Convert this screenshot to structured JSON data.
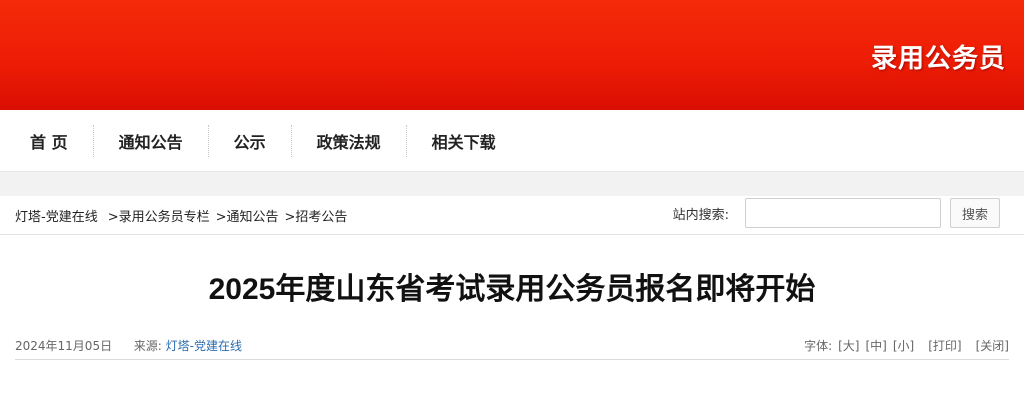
{
  "banner": {
    "title": "录用公务员"
  },
  "nav": {
    "items": [
      {
        "label": "首 页"
      },
      {
        "label": "通知公告"
      },
      {
        "label": "公示"
      },
      {
        "label": "政策法规"
      },
      {
        "label": "相关下载"
      }
    ]
  },
  "breadcrumb": {
    "items": [
      "灯塔-党建在线",
      ">录用公务员专栏",
      ">通知公告",
      ">招考公告"
    ]
  },
  "search": {
    "label": "站内搜索:",
    "input_value": "",
    "button_label": "搜索"
  },
  "article": {
    "title": "2025年度山东省考试录用公务员报名即将开始",
    "date": "2024年11月05日",
    "source_label": "来源:",
    "source_link": "灯塔-党建在线",
    "font_label": "字体:",
    "font_large": "[大]",
    "font_medium": "[中]",
    "font_small": "[小]",
    "print": "[打印]",
    "close": "[关闭]"
  }
}
